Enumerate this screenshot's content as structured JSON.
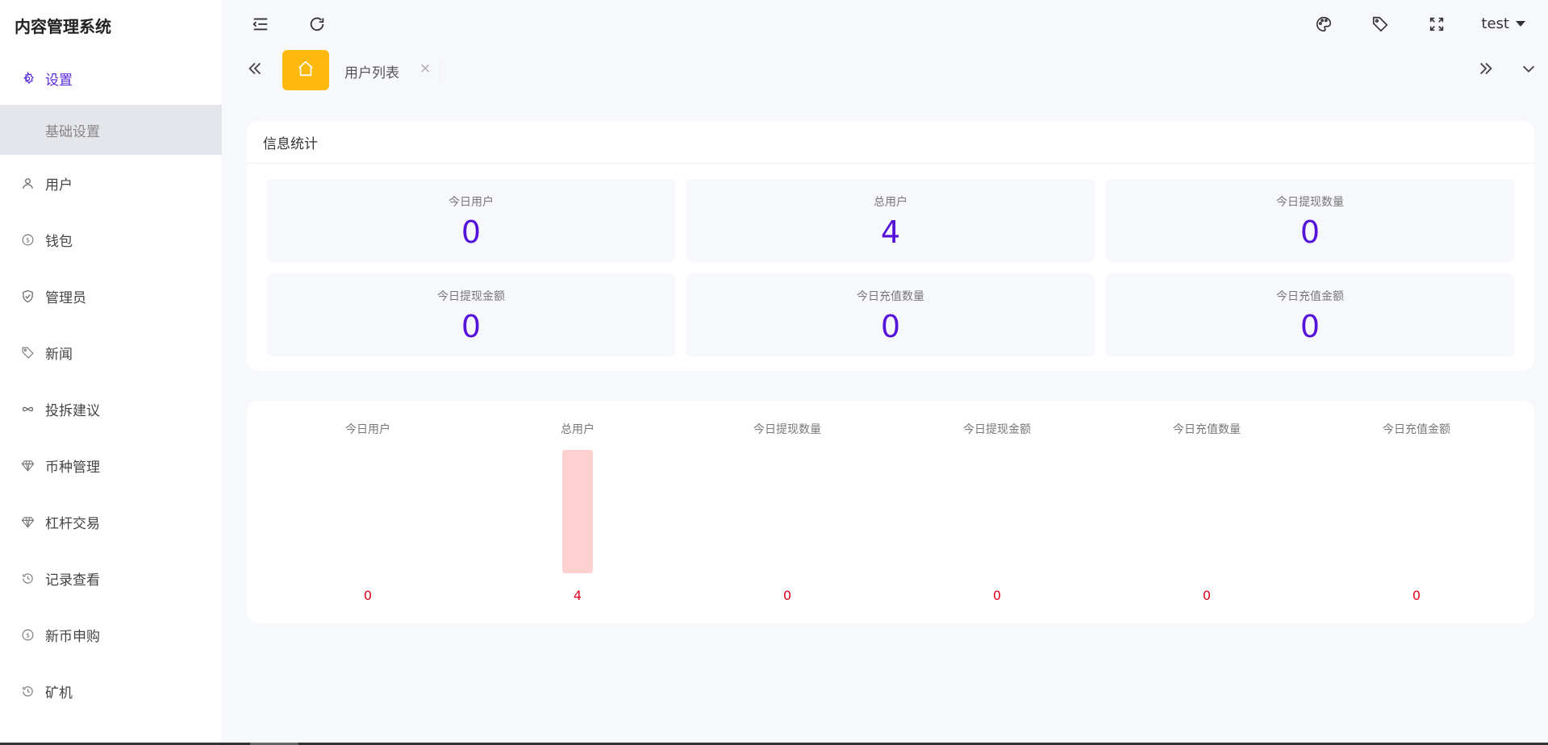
{
  "app": {
    "title": "内容管理系统"
  },
  "sidebar": {
    "items": [
      {
        "label": "设置",
        "icon": "gear-icon",
        "active": true
      },
      {
        "label": "用户",
        "icon": "user-icon"
      },
      {
        "label": "钱包",
        "icon": "coin-icon"
      },
      {
        "label": "管理员",
        "icon": "shield-icon"
      },
      {
        "label": "新闻",
        "icon": "tag-icon"
      },
      {
        "label": "投拆建议",
        "icon": "infinity-icon"
      },
      {
        "label": "币种管理",
        "icon": "diamond-icon"
      },
      {
        "label": "杠杆交易",
        "icon": "diamond-icon"
      },
      {
        "label": "记录查看",
        "icon": "history-icon"
      },
      {
        "label": "新币申购",
        "icon": "coin-icon"
      },
      {
        "label": "矿机",
        "icon": "history-icon"
      }
    ],
    "sub_item": "基础设置"
  },
  "topbar": {
    "user": "test"
  },
  "tabs": {
    "current": "用户列表",
    "close": "×"
  },
  "stats_card": {
    "title": "信息统计",
    "stats": [
      {
        "label": "今日用户",
        "value": "0"
      },
      {
        "label": "总用户",
        "value": "4"
      },
      {
        "label": "今日提现数量",
        "value": "0"
      },
      {
        "label": "今日提现金额",
        "value": "0"
      },
      {
        "label": "今日充值数量",
        "value": "0"
      },
      {
        "label": "今日充值金额",
        "value": "0"
      }
    ]
  },
  "chart_data": {
    "type": "bar",
    "categories": [
      "今日用户",
      "总用户",
      "今日提现数量",
      "今日提现金额",
      "今日充值数量",
      "今日充值金额"
    ],
    "values": [
      0,
      4,
      0,
      0,
      0,
      0
    ],
    "ylim": [
      0,
      4
    ],
    "grid": false,
    "colors": {
      "bar": "#ffd0d0",
      "value_label": "#e0001b",
      "category_label": "#777777"
    }
  }
}
